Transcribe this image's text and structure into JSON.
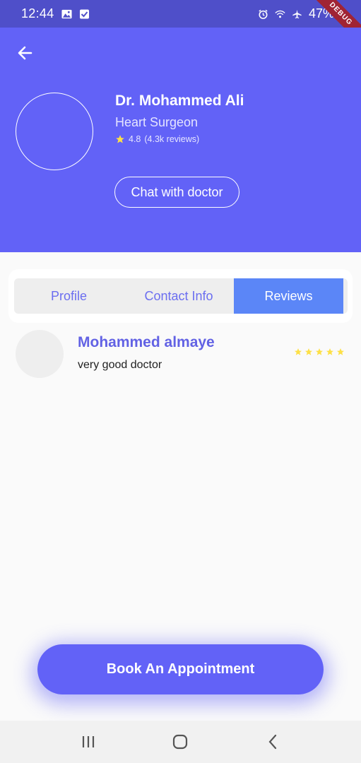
{
  "status_bar": {
    "time": "12:44",
    "battery": "47%",
    "debug_banner": "DEBUG",
    "background": "#4f4fc9"
  },
  "header": {
    "background": "#6262f7",
    "back_icon": "arrow-left-icon",
    "doctor_name": "Dr. Mohammed Ali",
    "specialty": "Heart Surgeon",
    "rating": "4.8",
    "reviews_count": "(4.3k reviews)",
    "chat_button_label": "Chat with doctor"
  },
  "tabs": [
    {
      "label": "Profile",
      "active": false
    },
    {
      "label": "Contact Info",
      "active": false
    },
    {
      "label": "Reviews",
      "active": true
    }
  ],
  "reviews": [
    {
      "name": "Mohammed almaye",
      "text": "very good doctor",
      "stars": 5
    }
  ],
  "book_button_label": "Book An Appointment",
  "colors": {
    "accent": "#6262f7",
    "active_tab": "#5b86f7",
    "star": "#fde047"
  }
}
